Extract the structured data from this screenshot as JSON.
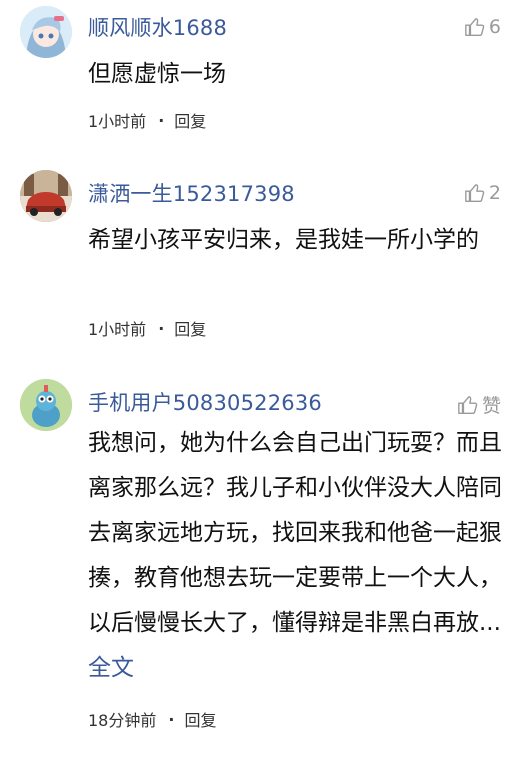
{
  "comments": [
    {
      "username": "顺风顺水1688",
      "likes": "6",
      "text": "但愿虚惊一场",
      "time": "1小时前",
      "separator": "·",
      "reply_label": "回复"
    },
    {
      "username": "潇洒一生152317398",
      "likes": "2",
      "text": "希望小孩平安归来，是我娃一所小学的",
      "time": "1小时前",
      "separator": "·",
      "reply_label": "回复"
    },
    {
      "username": "手机用户50830522636",
      "likes": "赞",
      "text": "我想问，她为什么会自己出门玩耍？而且离家那么远？我儿子和小伙伴没大人陪同去离家远地方玩，找回来我和他爸一起狠揍，教育他想去玩一定要带上一个大人，以后慢慢长大了，懂得辩是非黑白再放...",
      "full_text_link": "全文",
      "time": "18分钟前",
      "separator": "·",
      "reply_label": "回复"
    }
  ],
  "colors": {
    "username": "#3a5a9a",
    "link": "#3a5a9a",
    "muted": "#9a9a9a"
  },
  "icons": {
    "like": "thumbs-up-icon"
  }
}
